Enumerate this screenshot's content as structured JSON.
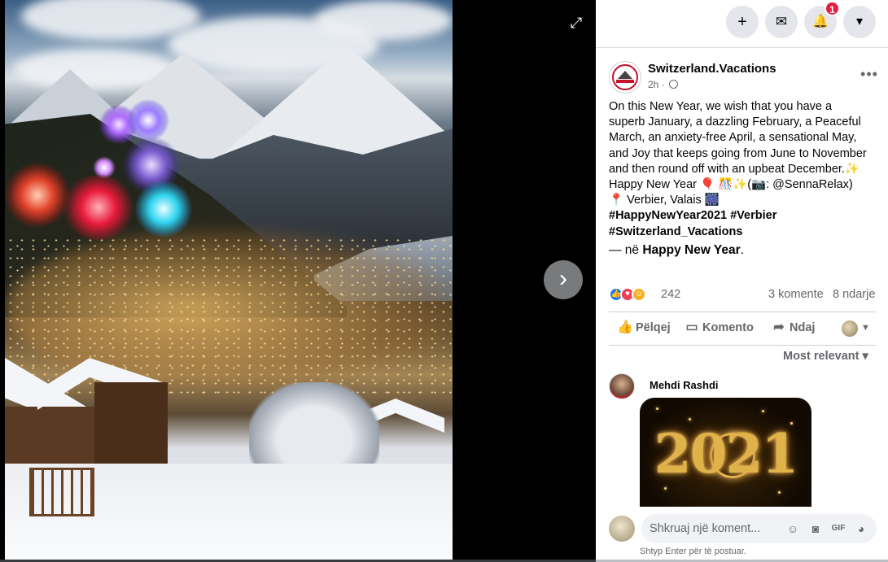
{
  "viewer": {
    "expand_icon": "expand-icon",
    "next_icon": "chevron-right-icon",
    "expand_glyph": "⤢",
    "next_glyph": "›"
  },
  "topbar": {
    "create_icon": "plus-icon",
    "messenger_icon": "messenger-icon",
    "notifications_icon": "bell-icon",
    "notifications_badge": "1",
    "account_icon": "caret-down-icon",
    "create_glyph": "+",
    "messenger_glyph": "✉",
    "notifications_glyph": "🔔",
    "account_glyph": "▾"
  },
  "post": {
    "page_name": "Switzerland.Vacations",
    "time": "2h ·",
    "more_glyph": "•••",
    "text_lines": [
      "On this New Year, we wish that you have a",
      "superb January, a dazzling February, a Peaceful",
      "March, an anxiety-free April, a sensational May,",
      "and Joy that keeps going from June to November",
      "and then round off with an upbeat December.✨",
      "Happy New Year 🎈 🎊✨(📷: @SennaRelax)",
      "📍 Verbier, Valais 🎆"
    ],
    "hashtags_line1": "#HappyNewYear2021 #Verbier",
    "hashtags_line2": "#Switzerland_Vacations",
    "feeling_prefix": "— në ",
    "feeling_value": "Happy New Year",
    "feeling_suffix": ".",
    "reaction_count": "242",
    "comments_count": "3 komente",
    "shares_count": "8 ndarje",
    "like_label": "Pëlqej",
    "comment_label": "Komento",
    "share_label": "Ndaj",
    "sort_label": "Most relevant ▾"
  },
  "comment": {
    "author": "Mehdi Rashdi",
    "image_text": "2021"
  },
  "composer": {
    "placeholder": "Shkruaj një koment...",
    "hint": "Shtyp Enter për të postuar."
  },
  "colors": {
    "accent": "#1877f2",
    "badge": "#e41e3f",
    "secondary_text": "#65676b"
  }
}
